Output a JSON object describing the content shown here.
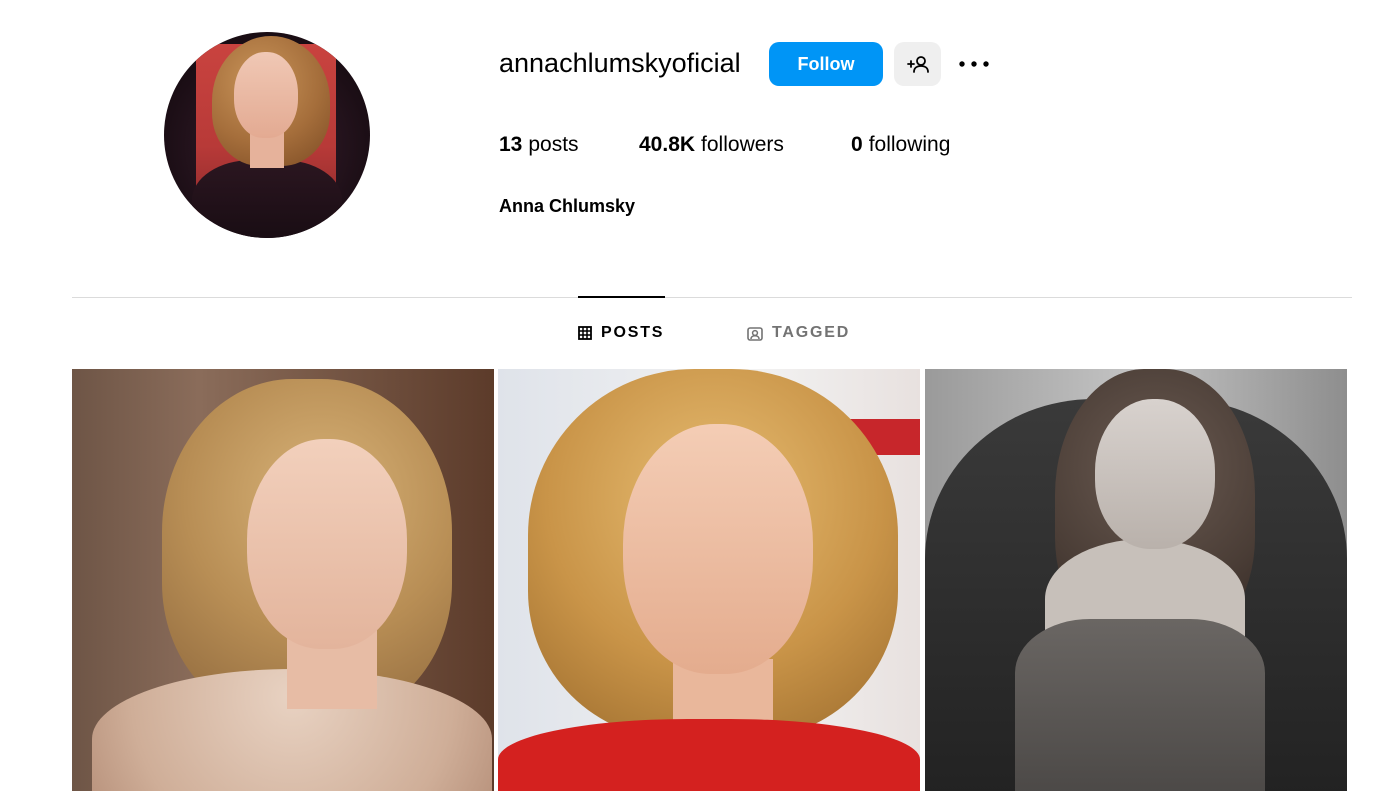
{
  "profile": {
    "username": "annachlumskyoficial",
    "full_name": "Anna Chlumsky",
    "avatar_alt": "profile photo"
  },
  "actions": {
    "follow_label": "Follow",
    "add_friend_icon": "person-add-icon",
    "more_icon": "more-horizontal-icon"
  },
  "stats": {
    "posts_count": "13",
    "posts_label": "posts",
    "followers_count": "40.8K",
    "followers_label": "followers",
    "following_count": "0",
    "following_label": "following"
  },
  "tabs": [
    {
      "label": "POSTS",
      "icon": "grid-icon",
      "active": true
    },
    {
      "label": "TAGGED",
      "icon": "tagged-icon",
      "active": false
    }
  ],
  "colors": {
    "accent": "#0095f6",
    "divider": "#dbdbdb",
    "inactive_tab": "#737373",
    "secondary_button": "#efefef"
  },
  "grid": [
    {
      "kind": "photo",
      "description": "post-1"
    },
    {
      "kind": "photo",
      "description": "post-2"
    },
    {
      "kind": "photo",
      "description": "post-3"
    }
  ]
}
